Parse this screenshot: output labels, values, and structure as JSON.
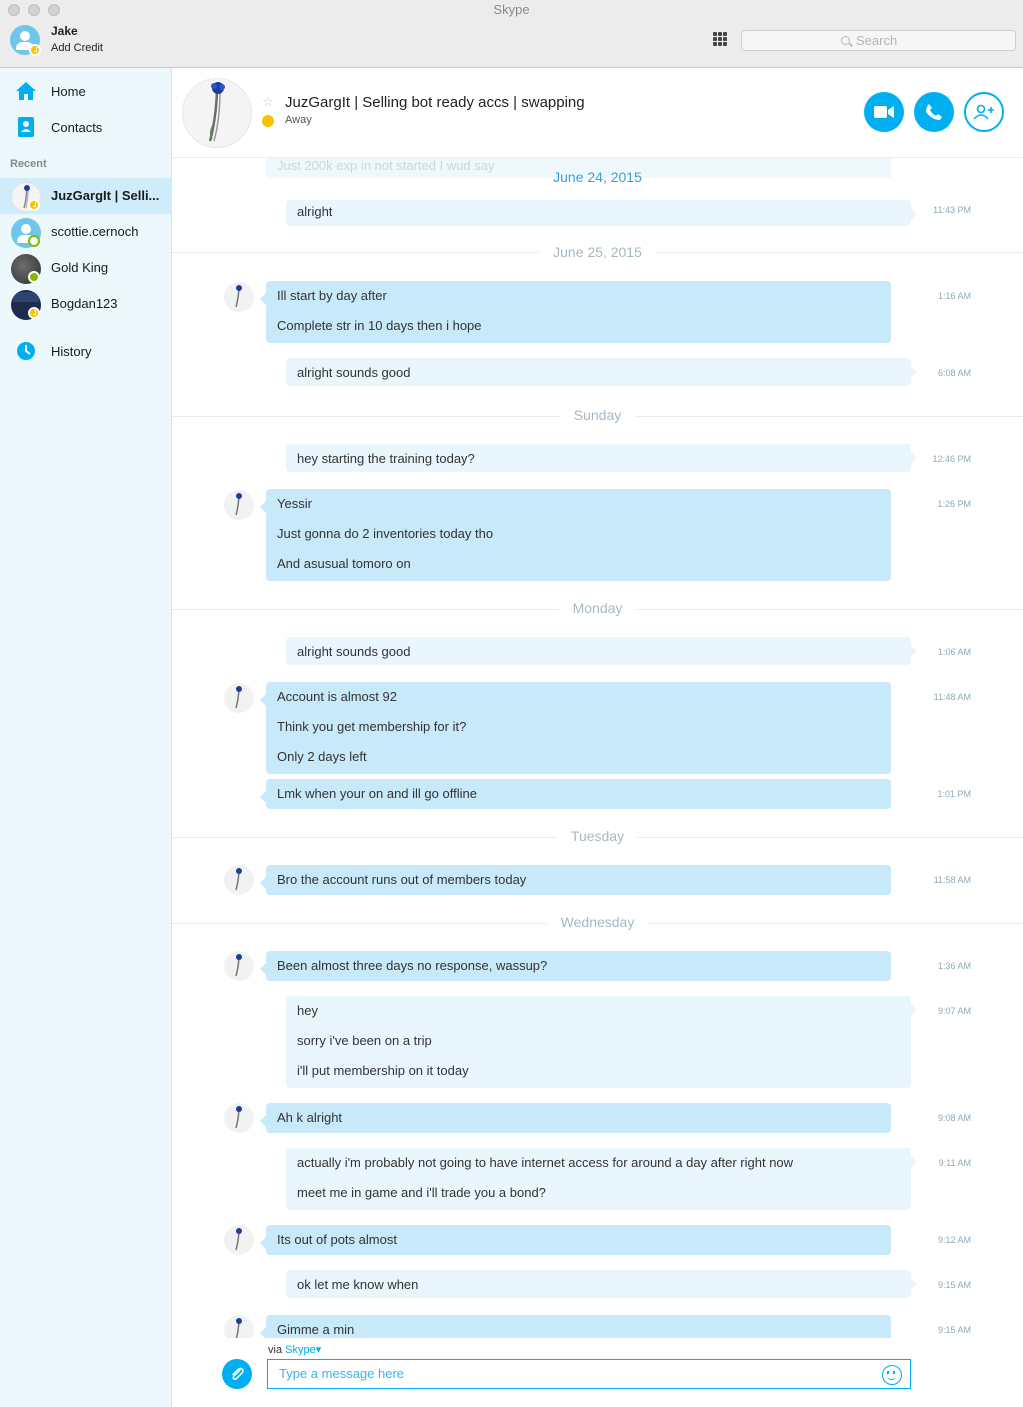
{
  "window": {
    "title": "Skype"
  },
  "profile": {
    "name": "Jake",
    "credit_label": "Add Credit"
  },
  "search": {
    "placeholder": "Search"
  },
  "nav": {
    "home": "Home",
    "contacts": "Contacts",
    "recent_header": "Recent",
    "history": "History"
  },
  "recent": [
    {
      "name": "JuzGargIt | Selli...",
      "status": "away",
      "active": true
    },
    {
      "name": "scottie.cernoch",
      "status": "offline",
      "active": false
    },
    {
      "name": "Gold King",
      "status": "online",
      "active": false
    },
    {
      "name": "Bogdan123",
      "status": "away",
      "active": false
    }
  ],
  "chat": {
    "title": "JuzGargIt | Selling bot ready accs | swapping",
    "status": "Away",
    "ghost_text": "Just 200k exp in not started I wud say",
    "dates": {
      "d1": "June 24, 2015",
      "d2": "June 25, 2015",
      "d3": "Sunday",
      "d4": "Monday",
      "d5": "Tuesday",
      "d6": "Wednesday"
    },
    "messages": [
      {
        "lines": [
          "alright"
        ],
        "time": "11:43 PM"
      },
      {
        "lines": [
          "Ill start by day after",
          "Complete str in 10 days then i hope"
        ],
        "time": "1:16 AM"
      },
      {
        "lines": [
          "alright sounds good"
        ],
        "time": "6:08 AM"
      },
      {
        "lines": [
          "hey starting the training today?"
        ],
        "time": "12:46 PM"
      },
      {
        "lines": [
          "Yessir",
          "Just gonna do 2 inventories today tho",
          "And asusual tomoro on"
        ],
        "time": "1:26 PM"
      },
      {
        "lines": [
          "alright sounds good"
        ],
        "time": "1:06 AM"
      },
      {
        "lines": [
          "Account is almost 92",
          "Think you get membership for it?",
          "Only 2 days left"
        ],
        "time": "11:48 AM"
      },
      {
        "lines": [
          "Lmk when your on and ill go offline"
        ],
        "time": "1:01 PM"
      },
      {
        "lines": [
          "Bro the account runs out of members today"
        ],
        "time": "11:58 AM"
      },
      {
        "lines": [
          "Been almost three days no response, wassup?"
        ],
        "time": "1:36 AM"
      },
      {
        "lines": [
          "hey",
          "sorry i've been on a trip",
          "i'll put membership on it today"
        ],
        "time": "9:07 AM"
      },
      {
        "lines": [
          "Ah k alright"
        ],
        "time": "9:08 AM"
      },
      {
        "lines": [
          "actually i'm probably not going to have internet access for around a day after right now",
          "meet me in game and i'll trade you a bond?"
        ],
        "time": "9:11 AM"
      },
      {
        "lines": [
          "Its out of pots almost"
        ],
        "time": "9:12 AM"
      },
      {
        "lines": [
          "ok let me know when"
        ],
        "time": "9:15 AM"
      },
      {
        "lines": [
          "Gimme a min"
        ],
        "time": "9:15 AM"
      }
    ]
  },
  "compose": {
    "via_label": "via",
    "via_service": "Skype",
    "placeholder": "Type a message here"
  },
  "colors": {
    "accent": "#00aff0",
    "incoming": "#c7e9fa",
    "outgoing": "#e9f6fd",
    "away": "#f8c300",
    "online": "#7dba00"
  }
}
